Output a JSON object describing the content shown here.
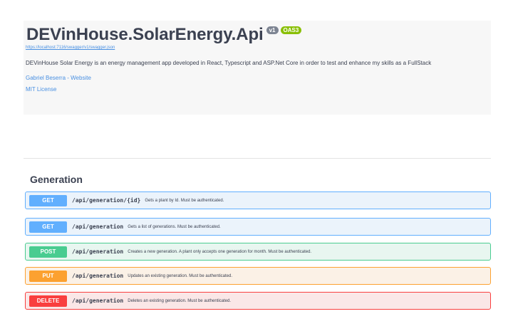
{
  "info": {
    "title": "DEVinHouse.SolarEnergy.Api",
    "version_badge": "v1",
    "oas_badge": "OAS3",
    "spec_url": "https://localhost:7116/swagger/v1/swagger.json",
    "description": "DEVinHouse Solar Energy is an energy management app developed in React, Typescript and ASP.Net Core in order to test and enhance my skills as a FullStack",
    "contact_link": "Gabriel Beserra - Website",
    "license_link": "MIT License"
  },
  "tag": {
    "name": "Generation"
  },
  "operations": [
    {
      "method": "GET",
      "path": "/api/generation/{id}",
      "summary": "Gets a plant by Id. Must be authenticated."
    },
    {
      "method": "GET",
      "path": "/api/generation",
      "summary": "Gets a list of generations. Must be authenticated."
    },
    {
      "method": "POST",
      "path": "/api/generation",
      "summary": "Creates a new generation. A plant only accepts one generation for month. Must be authenticated."
    },
    {
      "method": "PUT",
      "path": "/api/generation",
      "summary": "Updates an existing generation. Must be authenticated."
    },
    {
      "method": "DELETE",
      "path": "/api/generation",
      "summary": "Deletes an existing generation. Must be authenticated."
    }
  ],
  "colors": {
    "get": "#61affe",
    "post": "#49cc90",
    "put": "#fca130",
    "delete": "#f93e3e",
    "link": "#4990e2"
  }
}
